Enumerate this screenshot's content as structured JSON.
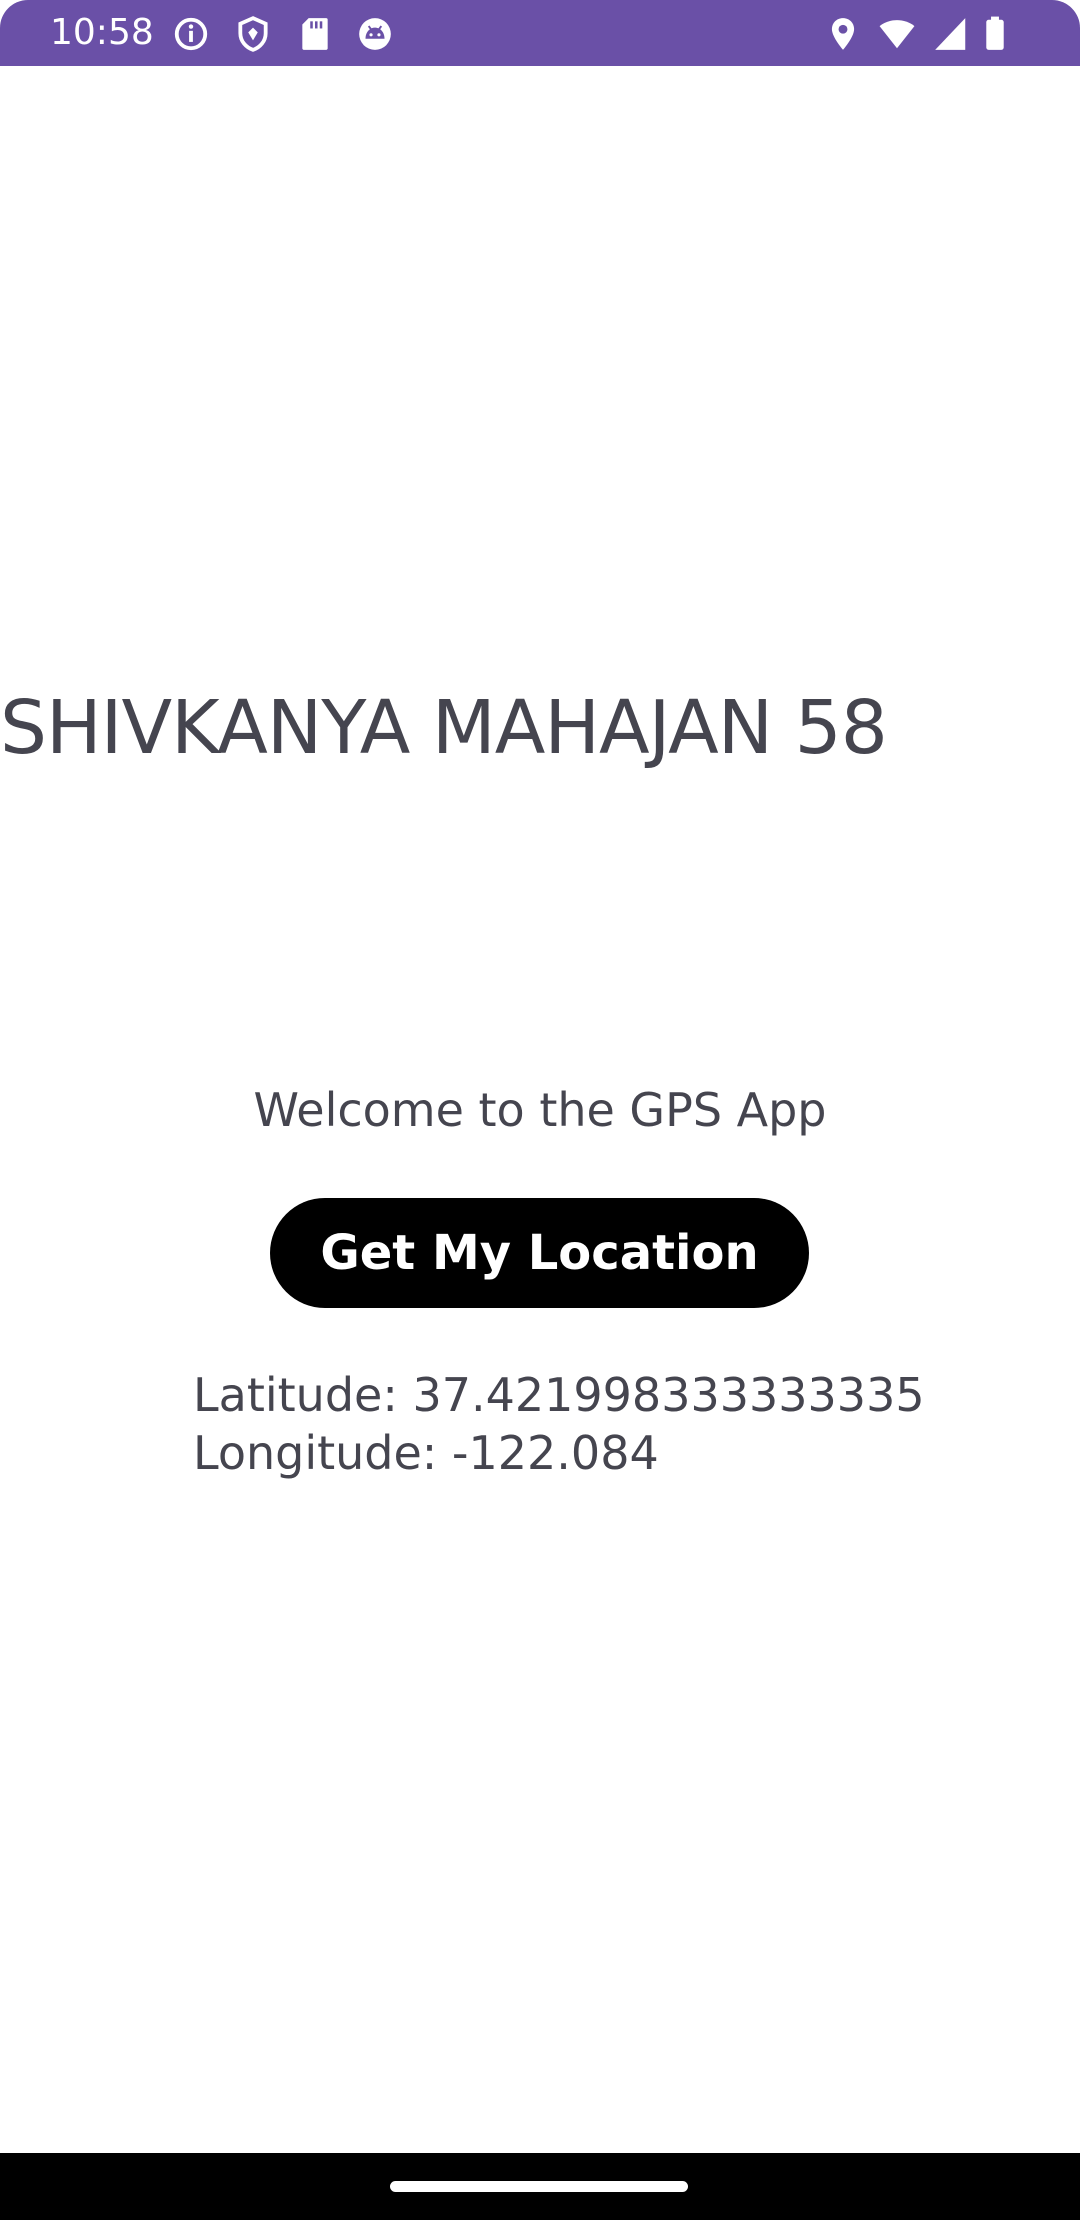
{
  "status_bar": {
    "time": "10:58",
    "background_color": "#6a50a7",
    "left_icons": [
      "info-icon",
      "shield-icon",
      "sd-card-icon",
      "android-face-icon"
    ],
    "right_icons": [
      "location-icon",
      "wifi-icon",
      "battery-icon"
    ]
  },
  "main": {
    "author_title": "SHIVKANYA MAHAJAN 58",
    "welcome_text": "Welcome to the GPS App",
    "get_location_button_label": "Get My Location",
    "latitude_text": "Latitude: 37.421998333333335",
    "longitude_text": "Longitude: -122.084",
    "text_color": "#45454f",
    "button_color": "#000000"
  },
  "nav_bar": {
    "background_color": "#000000",
    "handle": "home-handle"
  }
}
